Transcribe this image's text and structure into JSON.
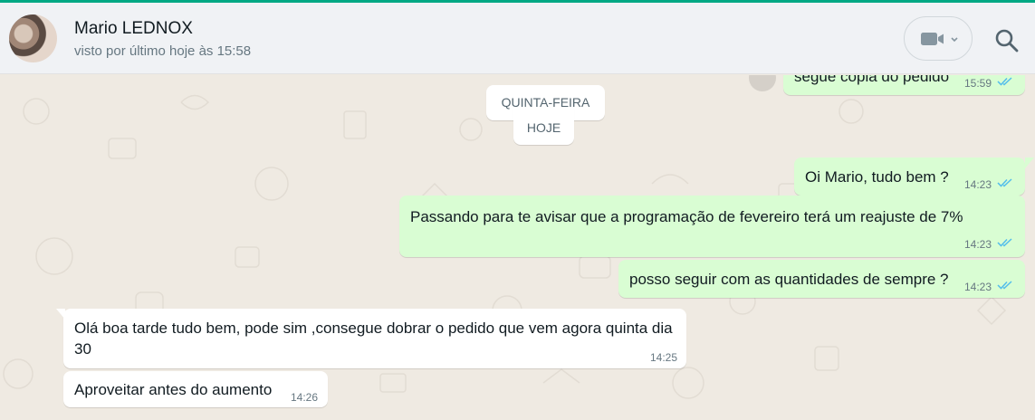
{
  "header": {
    "contact_name": "Mario LEDNOX",
    "status": "visto por último hoje às 15:58",
    "icons": [
      "avatar",
      "video-call-icon",
      "chevron-down-icon",
      "search-icon"
    ]
  },
  "day_separator": {
    "day": "QUINTA-FEIRA",
    "today": "HOJE"
  },
  "messages": [
    {
      "direction": "out",
      "text": "segue copia do pedido",
      "time": "15:59",
      "status": "read"
    },
    {
      "direction": "out",
      "text": "Oi Mario, tudo bem ?",
      "time": "14:23",
      "status": "read"
    },
    {
      "direction": "out",
      "text": "Passando para te avisar que a programação de fevereiro terá um reajuste de 7%",
      "time": "14:23",
      "status": "read"
    },
    {
      "direction": "out",
      "text": "posso seguir com as quantidades de sempre ?",
      "time": "14:23",
      "status": "read"
    },
    {
      "direction": "in",
      "text": "Olá boa tarde tudo bem, pode sim ,consegue dobrar o pedido que vem agora quinta dia 30",
      "time": "14:25"
    },
    {
      "direction": "in",
      "text": "Aproveitar antes do aumento",
      "time": "14:26"
    }
  ],
  "colors": {
    "accent": "#00a884",
    "outgoing_bubble": "#d9fdd3",
    "incoming_bubble": "#ffffff",
    "chat_background": "#efeae2",
    "read_ticks": "#53bdeb"
  }
}
